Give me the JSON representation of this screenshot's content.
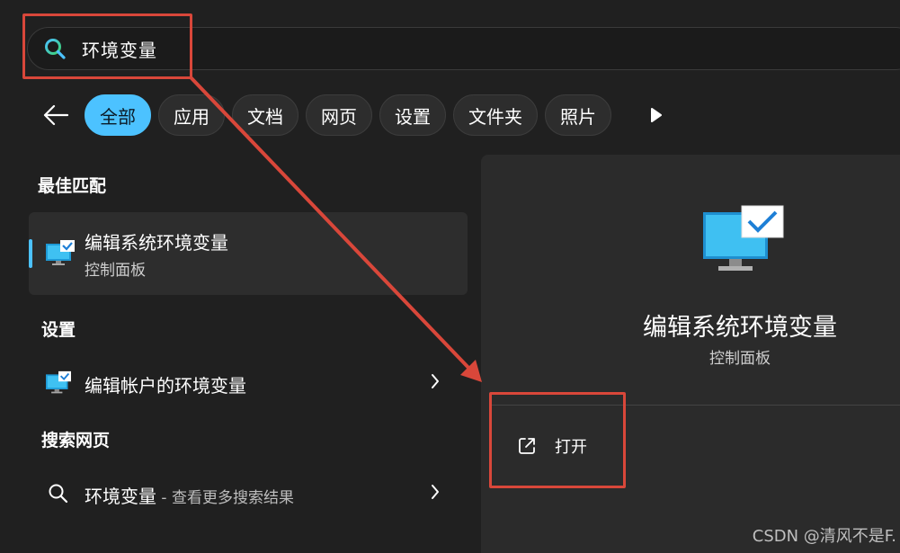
{
  "search": {
    "query": "环境变量"
  },
  "filters": [
    {
      "label": "全部",
      "active": true
    },
    {
      "label": "应用"
    },
    {
      "label": "文档"
    },
    {
      "label": "网页"
    },
    {
      "label": "设置"
    },
    {
      "label": "文件夹"
    },
    {
      "label": "照片"
    }
  ],
  "sections": {
    "best_match": "最佳匹配",
    "settings": "设置",
    "search_web": "搜索网页"
  },
  "best_match_item": {
    "title": "编辑系统环境变量",
    "subtitle": "控制面板",
    "icon": "monitor-check-icon"
  },
  "settings_item": {
    "title": "编辑帐户的环境变量",
    "icon": "monitor-check-icon"
  },
  "web_item": {
    "title": "环境变量",
    "suffix": " - 查看更多搜索结果",
    "icon": "search-icon"
  },
  "preview": {
    "title": "编辑系统环境变量",
    "subtitle": "控制面板",
    "open_label": "打开"
  },
  "watermark": "CSDN @清风不是F.",
  "colors": {
    "accent": "#4cc2ff",
    "annotation": "#d9473a",
    "background": "#202020"
  }
}
